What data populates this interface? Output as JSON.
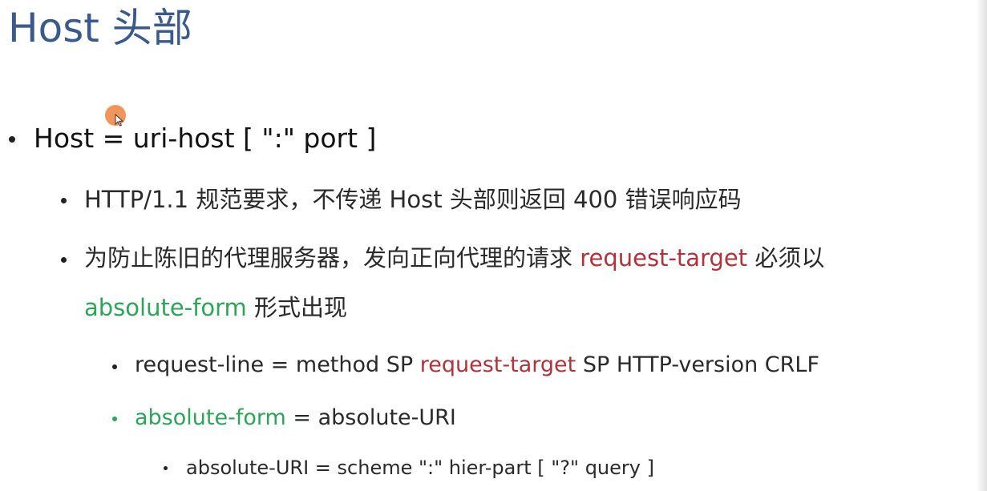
{
  "title": "Host 头部",
  "bullet1": {
    "text": "Host = uri-host [ \":\" port ]"
  },
  "bullet1_1": {
    "text": "HTTP/1.1 规范要求，不传递 Host 头部则返回 400 错误响应码"
  },
  "bullet1_2": {
    "line1_before": "为防止陈旧的代理服务器，发向正向代理的请求 ",
    "line1_highlight": "request-target",
    "line1_after": " 必须以",
    "line2_highlight": "absolute-form",
    "line2_after": " 形式出现"
  },
  "bullet1_2_1": {
    "before": "request-line = method SP ",
    "highlight": "request-target",
    "after": " SP HTTP-version CRLF"
  },
  "bullet1_2_2": {
    "highlight": "absolute-form",
    "after": " = absolute-URI"
  },
  "bullet1_2_2_1": {
    "text": "absolute-URI = scheme \":\" hier-part [ \"?\" query ]"
  },
  "colors": {
    "title": "#3a5a8c",
    "red_highlight": "#b0323a",
    "green_highlight": "#2ea35a",
    "cursor": "#f2955a"
  }
}
